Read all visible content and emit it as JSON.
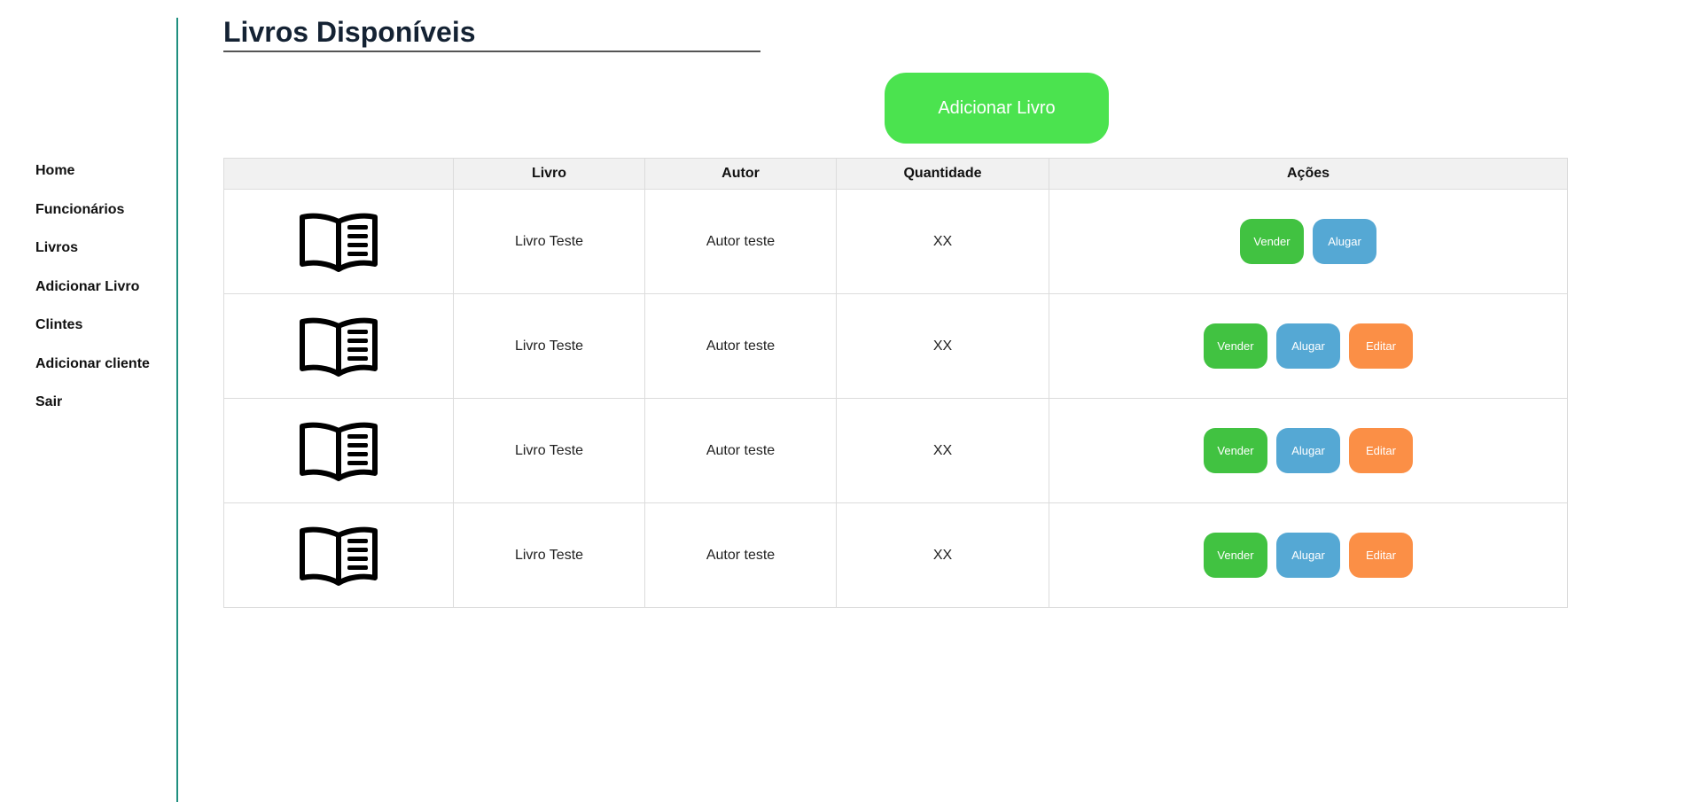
{
  "sidebar": {
    "items": [
      {
        "label": "Home"
      },
      {
        "label": "Funcionários"
      },
      {
        "label": "Livros"
      },
      {
        "label": "Adicionar Livro"
      },
      {
        "label": "Clintes"
      },
      {
        "label": "Adicionar cliente"
      },
      {
        "label": "Sair"
      }
    ]
  },
  "page": {
    "title": "Livros Disponíveis",
    "add_button": "Adicionar Livro"
  },
  "table": {
    "headers": [
      "",
      "Livro",
      "Autor",
      "Quantidade",
      "Ações"
    ],
    "rows": [
      {
        "icon": "open-book-icon",
        "livro": "Livro Teste",
        "autor": "Autor teste",
        "quantidade": "XX",
        "actions": [
          "Vender",
          "Alugar"
        ]
      },
      {
        "icon": "open-book-icon",
        "livro": "Livro Teste",
        "autor": "Autor teste",
        "quantidade": "XX",
        "actions": [
          "Vender",
          "Alugar",
          "Editar"
        ]
      },
      {
        "icon": "open-book-icon",
        "livro": "Livro Teste",
        "autor": "Autor teste",
        "quantidade": "XX",
        "actions": [
          "Vender",
          "Alugar",
          "Editar"
        ]
      },
      {
        "icon": "open-book-icon",
        "livro": "Livro Teste",
        "autor": "Autor teste",
        "quantidade": "XX",
        "actions": [
          "Vender",
          "Alugar",
          "Editar"
        ]
      }
    ]
  },
  "colors": {
    "sidebar_border": "#1f8f7f",
    "add_button": "#4be34f",
    "vender": "#41c241",
    "alugar": "#55a8d4",
    "editar": "#fb8f46"
  }
}
